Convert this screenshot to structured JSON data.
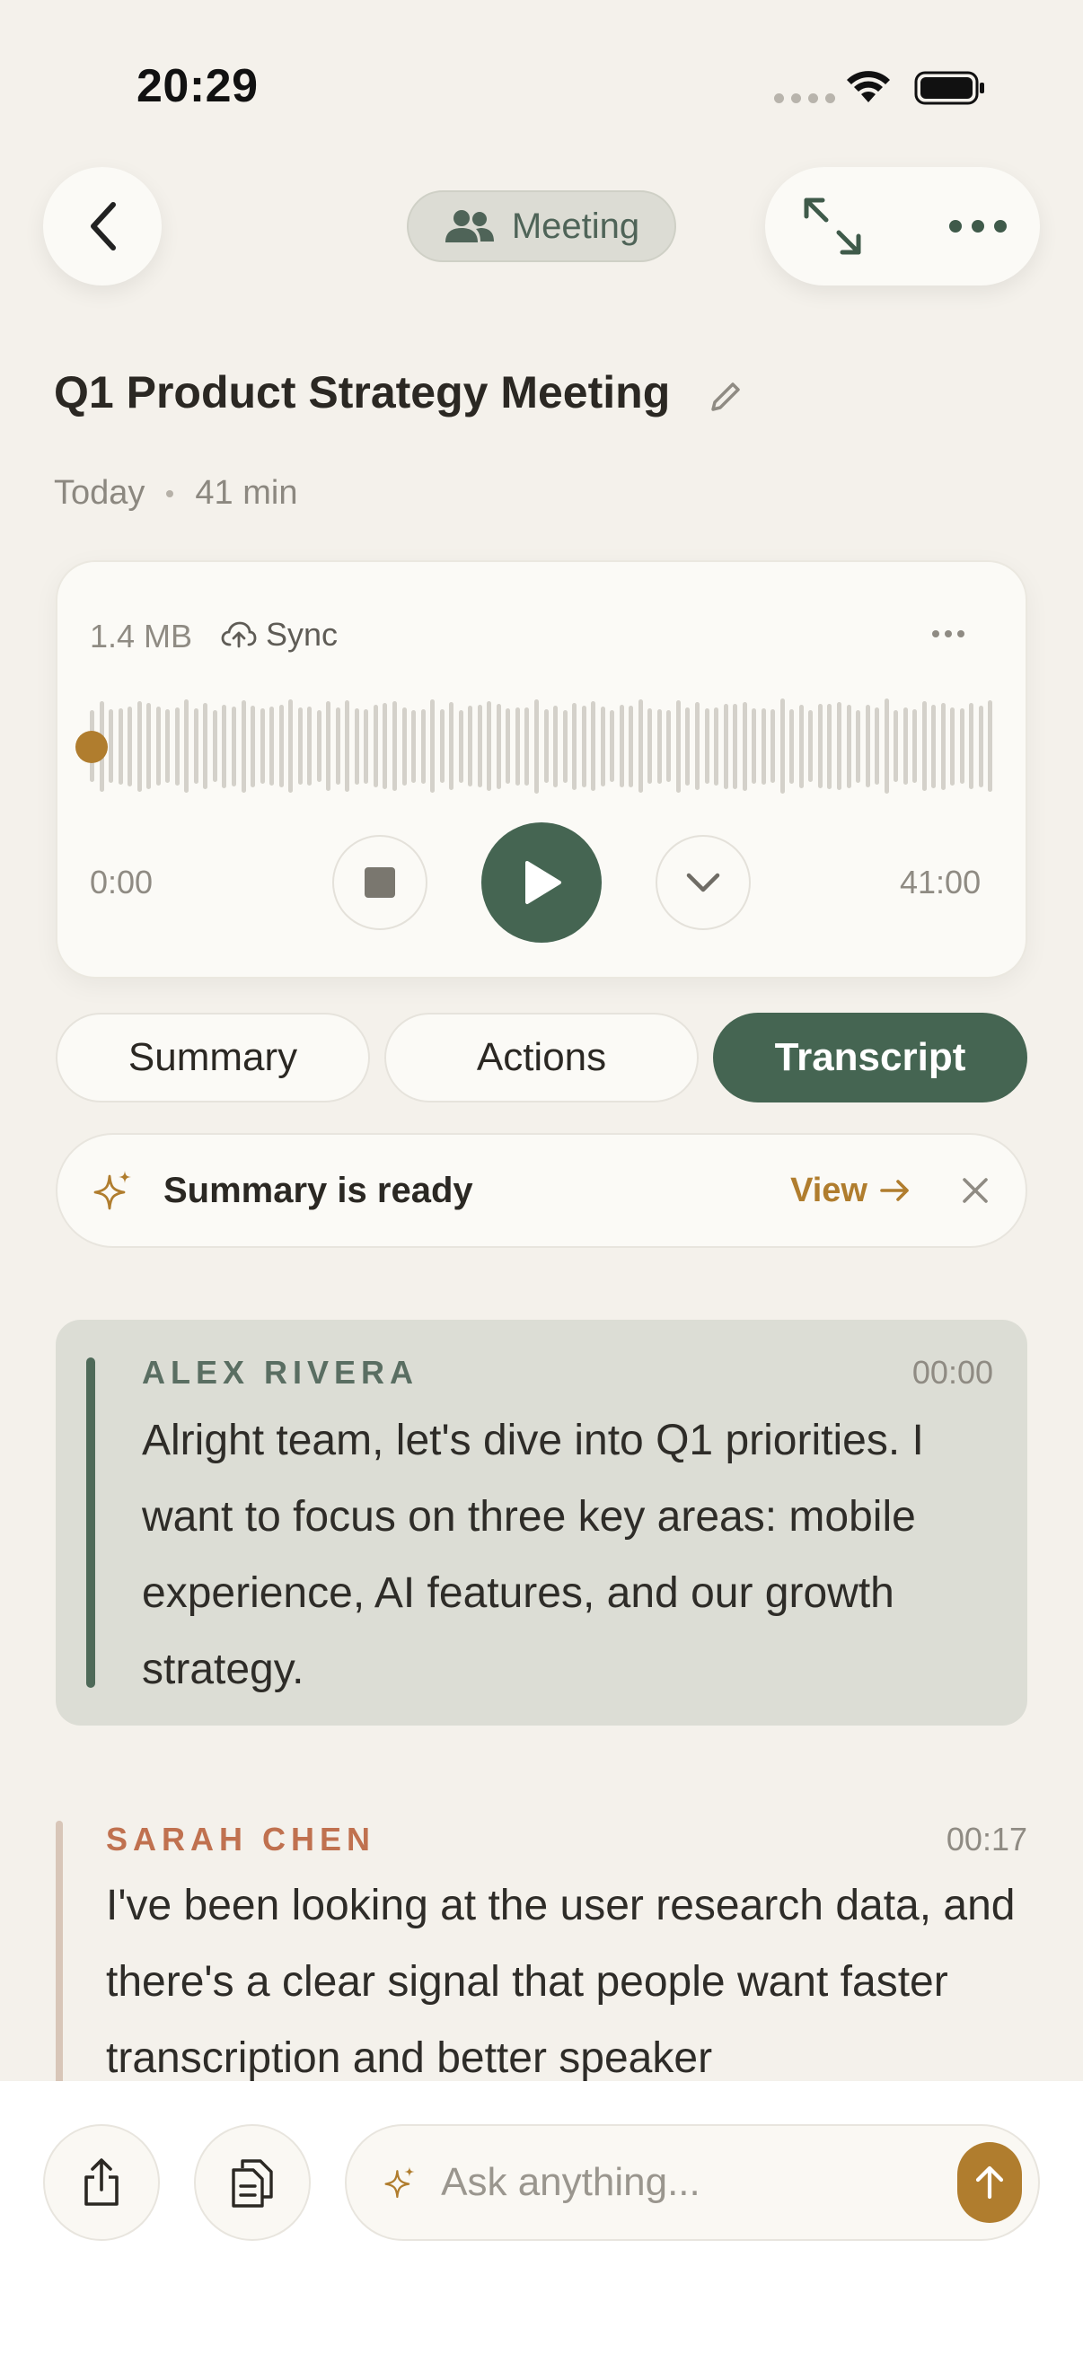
{
  "status_bar": {
    "time": "20:29"
  },
  "header": {
    "mode_label": "Meeting"
  },
  "recording": {
    "title": "Q1 Product Strategy Meeting",
    "date": "Today",
    "duration": "41 min",
    "file_size": "1.4 MB",
    "sync_label": "Sync",
    "time_start": "0:00",
    "time_end": "41:00",
    "progress": 0
  },
  "tabs": [
    {
      "label": "Summary",
      "active": false
    },
    {
      "label": "Actions",
      "active": false
    },
    {
      "label": "Transcript",
      "active": true
    }
  ],
  "banner": {
    "text": "Summary is ready",
    "view_label": "View"
  },
  "transcript": [
    {
      "speaker": "ALEX RIVERA",
      "time": "00:00",
      "text": "Alright team, let's dive into Q1 priorities. I want to focus on three key areas: mobile experience, AI features, and our growth strategy."
    },
    {
      "speaker": "SARAH CHEN",
      "time": "00:17",
      "text": "I've been looking at the user research data, and there's a clear signal that people want faster transcription and better speaker"
    }
  ],
  "composer": {
    "placeholder": "Ask anything..."
  },
  "colors": {
    "accent_green": "#456552",
    "accent_gold": "#b07d2e",
    "background": "#f4f1eb",
    "speaker_2": "#c0714f"
  }
}
